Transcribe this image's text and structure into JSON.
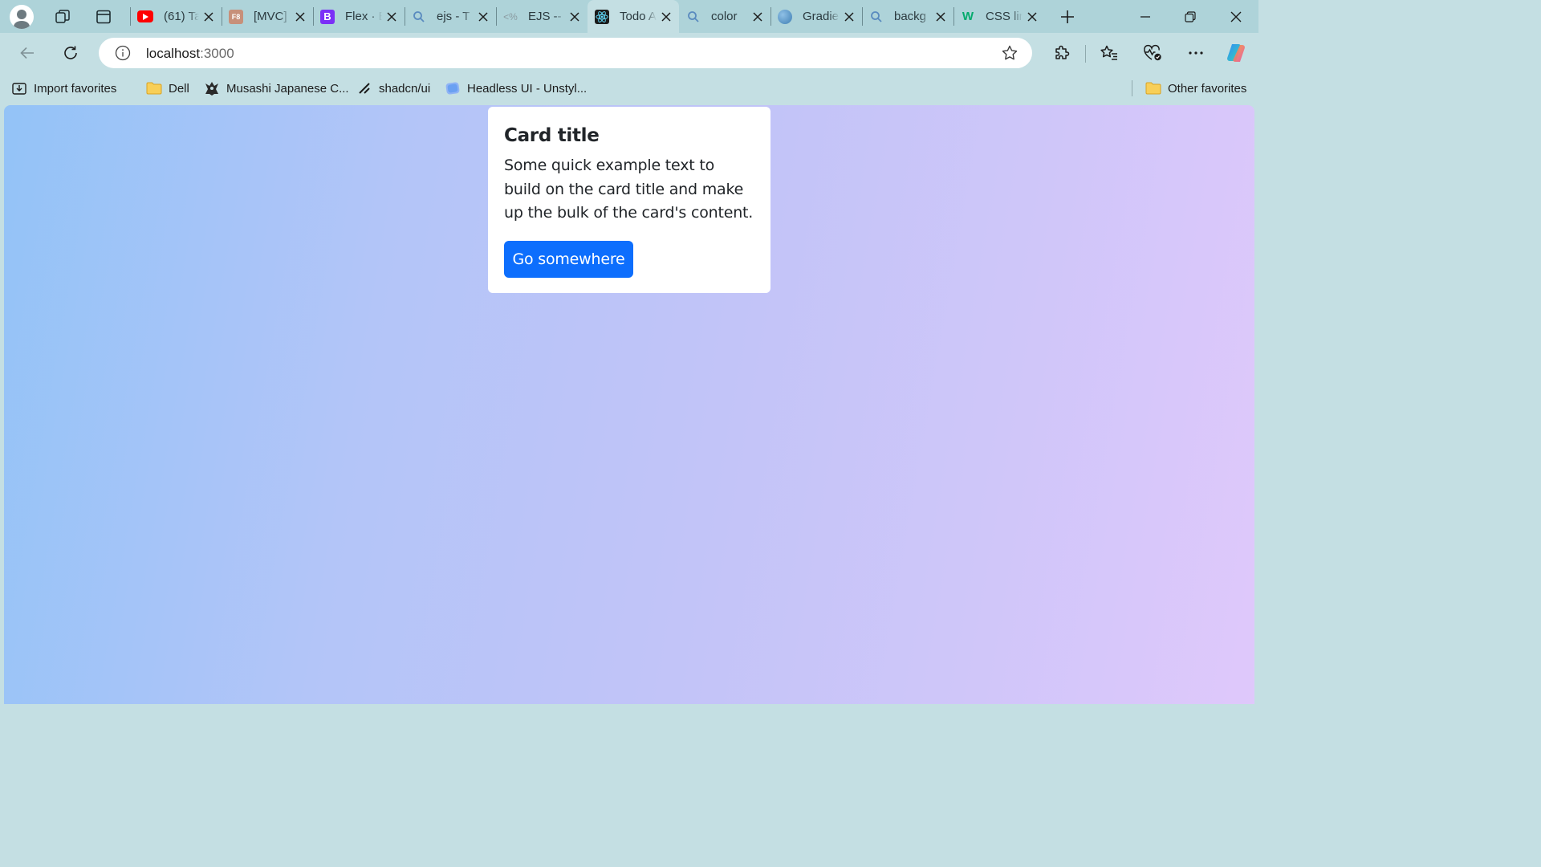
{
  "tabs": [
    {
      "title": "(61) Ta",
      "favicon": "youtube-icon",
      "color": "#ff0000"
    },
    {
      "title": "[MVC]",
      "favicon": "f8-icon",
      "color": "#c7907a",
      "glyph": "F8"
    },
    {
      "title": "Flex · B",
      "favicon": "bootstrap-icon",
      "color": "#7b2ff7",
      "glyph": "B"
    },
    {
      "title": "ejs - T",
      "favicon": "search-icon",
      "color": "#5a8bbf"
    },
    {
      "title": "EJS -- ",
      "favicon": "ejs-icon",
      "color": "#8a9aa0"
    },
    {
      "title": "Todo A",
      "favicon": "react-icon",
      "color": "#1b1b1b",
      "active": true
    },
    {
      "title": "color",
      "favicon": "search-icon",
      "color": "#5a8bbf"
    },
    {
      "title": "Gradie",
      "favicon": "gradient-globe-icon",
      "color": "#4f8fc6"
    },
    {
      "title": "backg",
      "favicon": "search-icon",
      "color": "#5a8bbf"
    },
    {
      "title": "CSS lin",
      "favicon": "w3schools-icon",
      "color": "#04aa6d",
      "glyph": "W"
    }
  ],
  "address_bar": {
    "host": "localhost",
    "port": ":3000"
  },
  "bookmarks": {
    "import": "Import favorites",
    "items": [
      "Dell",
      "Musashi Japanese C...",
      "shadcn/ui",
      "Headless UI - Unstyl..."
    ],
    "other": "Other favorites"
  },
  "card": {
    "title": "Card title",
    "text": "Some quick example text to build on the card title and make up the bulk of the card's content.",
    "button": "Go somewhere",
    "button_color": "#0d6efd"
  },
  "colors": {
    "frame": "#aed3d9",
    "toolbar": "#c4dfe3",
    "gradient_start": "#93c3f7",
    "gradient_end": "#dfc8fb"
  }
}
